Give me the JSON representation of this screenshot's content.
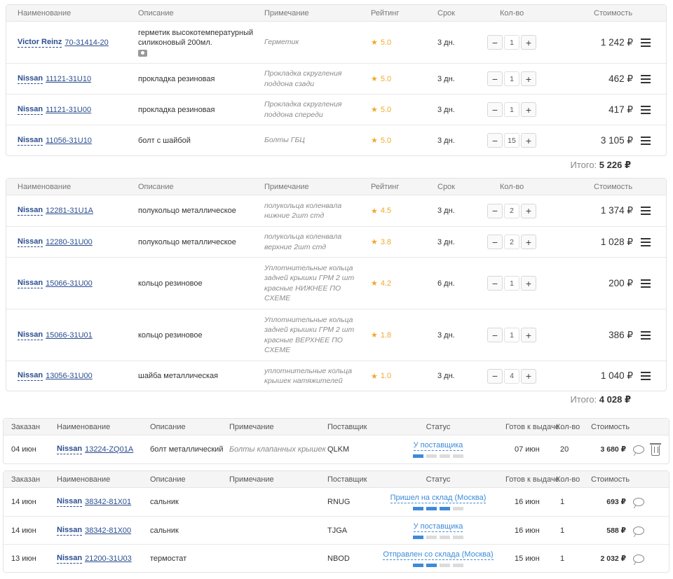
{
  "cart_headers": {
    "name": "Наименование",
    "desc": "Описание",
    "note": "Примечание",
    "rating": "Рейтинг",
    "term": "Срок",
    "qty": "Кол-во",
    "cost": "Стоимость"
  },
  "cart1": {
    "rows": [
      {
        "brand": "Victor Reinz",
        "article": "70-31414-20",
        "desc": "герметик высокотемпературный силиконовый 200мл.",
        "photo": true,
        "note": "Герметик",
        "rating": "5.0",
        "term": "3 дн.",
        "qty": "1",
        "cost": "1 242 ₽"
      },
      {
        "brand": "Nissan",
        "article": "11121-31U10",
        "desc": "прокладка резиновая",
        "note": "Прокладка скругления поддона сзади",
        "rating": "5.0",
        "term": "3 дн.",
        "qty": "1",
        "cost": "462 ₽"
      },
      {
        "brand": "Nissan",
        "article": "11121-31U00",
        "desc": "прокладка резиновая",
        "note": "Прокладка скругления поддона спереди",
        "rating": "5.0",
        "term": "3 дн.",
        "qty": "1",
        "cost": "417 ₽"
      },
      {
        "brand": "Nissan",
        "article": "11056-31U10",
        "desc": "болт с шайбой",
        "note": "Болты ГБЦ",
        "rating": "5.0",
        "term": "3 дн.",
        "qty": "15",
        "cost": "3 105 ₽"
      }
    ],
    "total_label": "Итого:",
    "total": "5 226 ₽"
  },
  "cart2": {
    "rows": [
      {
        "brand": "Nissan",
        "article": "12281-31U1A",
        "desc": "полукольцо металлическое",
        "note": "полукольца коленвала нижние 2шт стд",
        "rating": "4.5",
        "term": "3 дн.",
        "qty": "2",
        "cost": "1 374 ₽"
      },
      {
        "brand": "Nissan",
        "article": "12280-31U00",
        "desc": "полукольцо металлическое",
        "note": "полукольца коленвала верхние 2шт стд",
        "rating": "3.8",
        "term": "3 дн.",
        "qty": "2",
        "cost": "1 028 ₽"
      },
      {
        "brand": "Nissan",
        "article": "15066-31U00",
        "desc": "кольцо резиновое",
        "note": "Уплотнительные кольца задней крышки ГРМ 2 шт красные НИЖНЕЕ ПО СХЕМЕ",
        "rating": "4.2",
        "term": "6 дн.",
        "qty": "1",
        "cost": "200 ₽"
      },
      {
        "brand": "Nissan",
        "article": "15066-31U01",
        "desc": "кольцо резиновое",
        "note": "Уплотнительные кольца задней крышки ГРМ 2 шт красные ВЕРХНЕЕ ПО СХЕМЕ",
        "rating": "1.8",
        "term": "3 дн.",
        "qty": "1",
        "cost": "386 ₽"
      },
      {
        "brand": "Nissan",
        "article": "13056-31U00",
        "desc": "шайба металлическая",
        "note": "уплотнительные кольца крышек натяжителей",
        "rating": "1.0",
        "term": "3 дн.",
        "qty": "4",
        "cost": "1 040 ₽"
      }
    ],
    "total_label": "Итого:",
    "total": "4 028 ₽"
  },
  "order_headers": {
    "ordered": "Заказан",
    "name": "Наименование",
    "desc": "Описание",
    "note": "Примечание",
    "supplier": "Поставщик",
    "status": "Статус",
    "ready": "Готов к выдаче",
    "qty": "Кол-во",
    "cost": "Стоимость"
  },
  "orders1": [
    {
      "date": "04 июн",
      "brand": "Nissan",
      "article": "13224-ZQ01A",
      "desc": "болт металлический",
      "note": "Болты клапанных крышек",
      "supplier": "QLKM",
      "status": "У поставщика",
      "progress": 1,
      "ready": "07 июн",
      "qty": "20",
      "cost": "3 680 ₽"
    }
  ],
  "orders2": [
    {
      "date": "14 июн",
      "brand": "Nissan",
      "article": "38342-81X01",
      "desc": "сальник",
      "note": "",
      "supplier": "RNUG",
      "status": "Пришел на склад (Москва)",
      "progress": 3,
      "ready": "16 июн",
      "qty": "1",
      "cost": "693 ₽"
    },
    {
      "date": "14 июн",
      "brand": "Nissan",
      "article": "38342-81X00",
      "desc": "сальник",
      "note": "",
      "supplier": "TJGA",
      "status": "У поставщика",
      "progress": 1,
      "ready": "16 июн",
      "qty": "1",
      "cost": "588 ₽"
    },
    {
      "date": "13 июн",
      "brand": "Nissan",
      "article": "21200-31U03",
      "desc": "термостат",
      "note": "",
      "supplier": "NBOD",
      "status": "Отправлен со склада (Москва)",
      "progress": 2,
      "ready": "15 июн",
      "qty": "1",
      "cost": "2 032 ₽"
    }
  ],
  "colors": {
    "link": "#2a4d8f",
    "status": "#3d8bd9",
    "star": "#f0a92b"
  }
}
